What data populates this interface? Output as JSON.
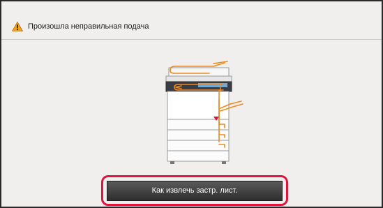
{
  "header": {
    "icon": "warning-icon",
    "title": "Произошла неправильная подача"
  },
  "illustration": {
    "icon": "copier-paper-path-icon",
    "path_color": "#ee8a1f",
    "jam_marker_color": "#e0143c"
  },
  "action": {
    "button_label": "Как извлечь застр. лист.",
    "highlight_color": "#e0143c"
  }
}
